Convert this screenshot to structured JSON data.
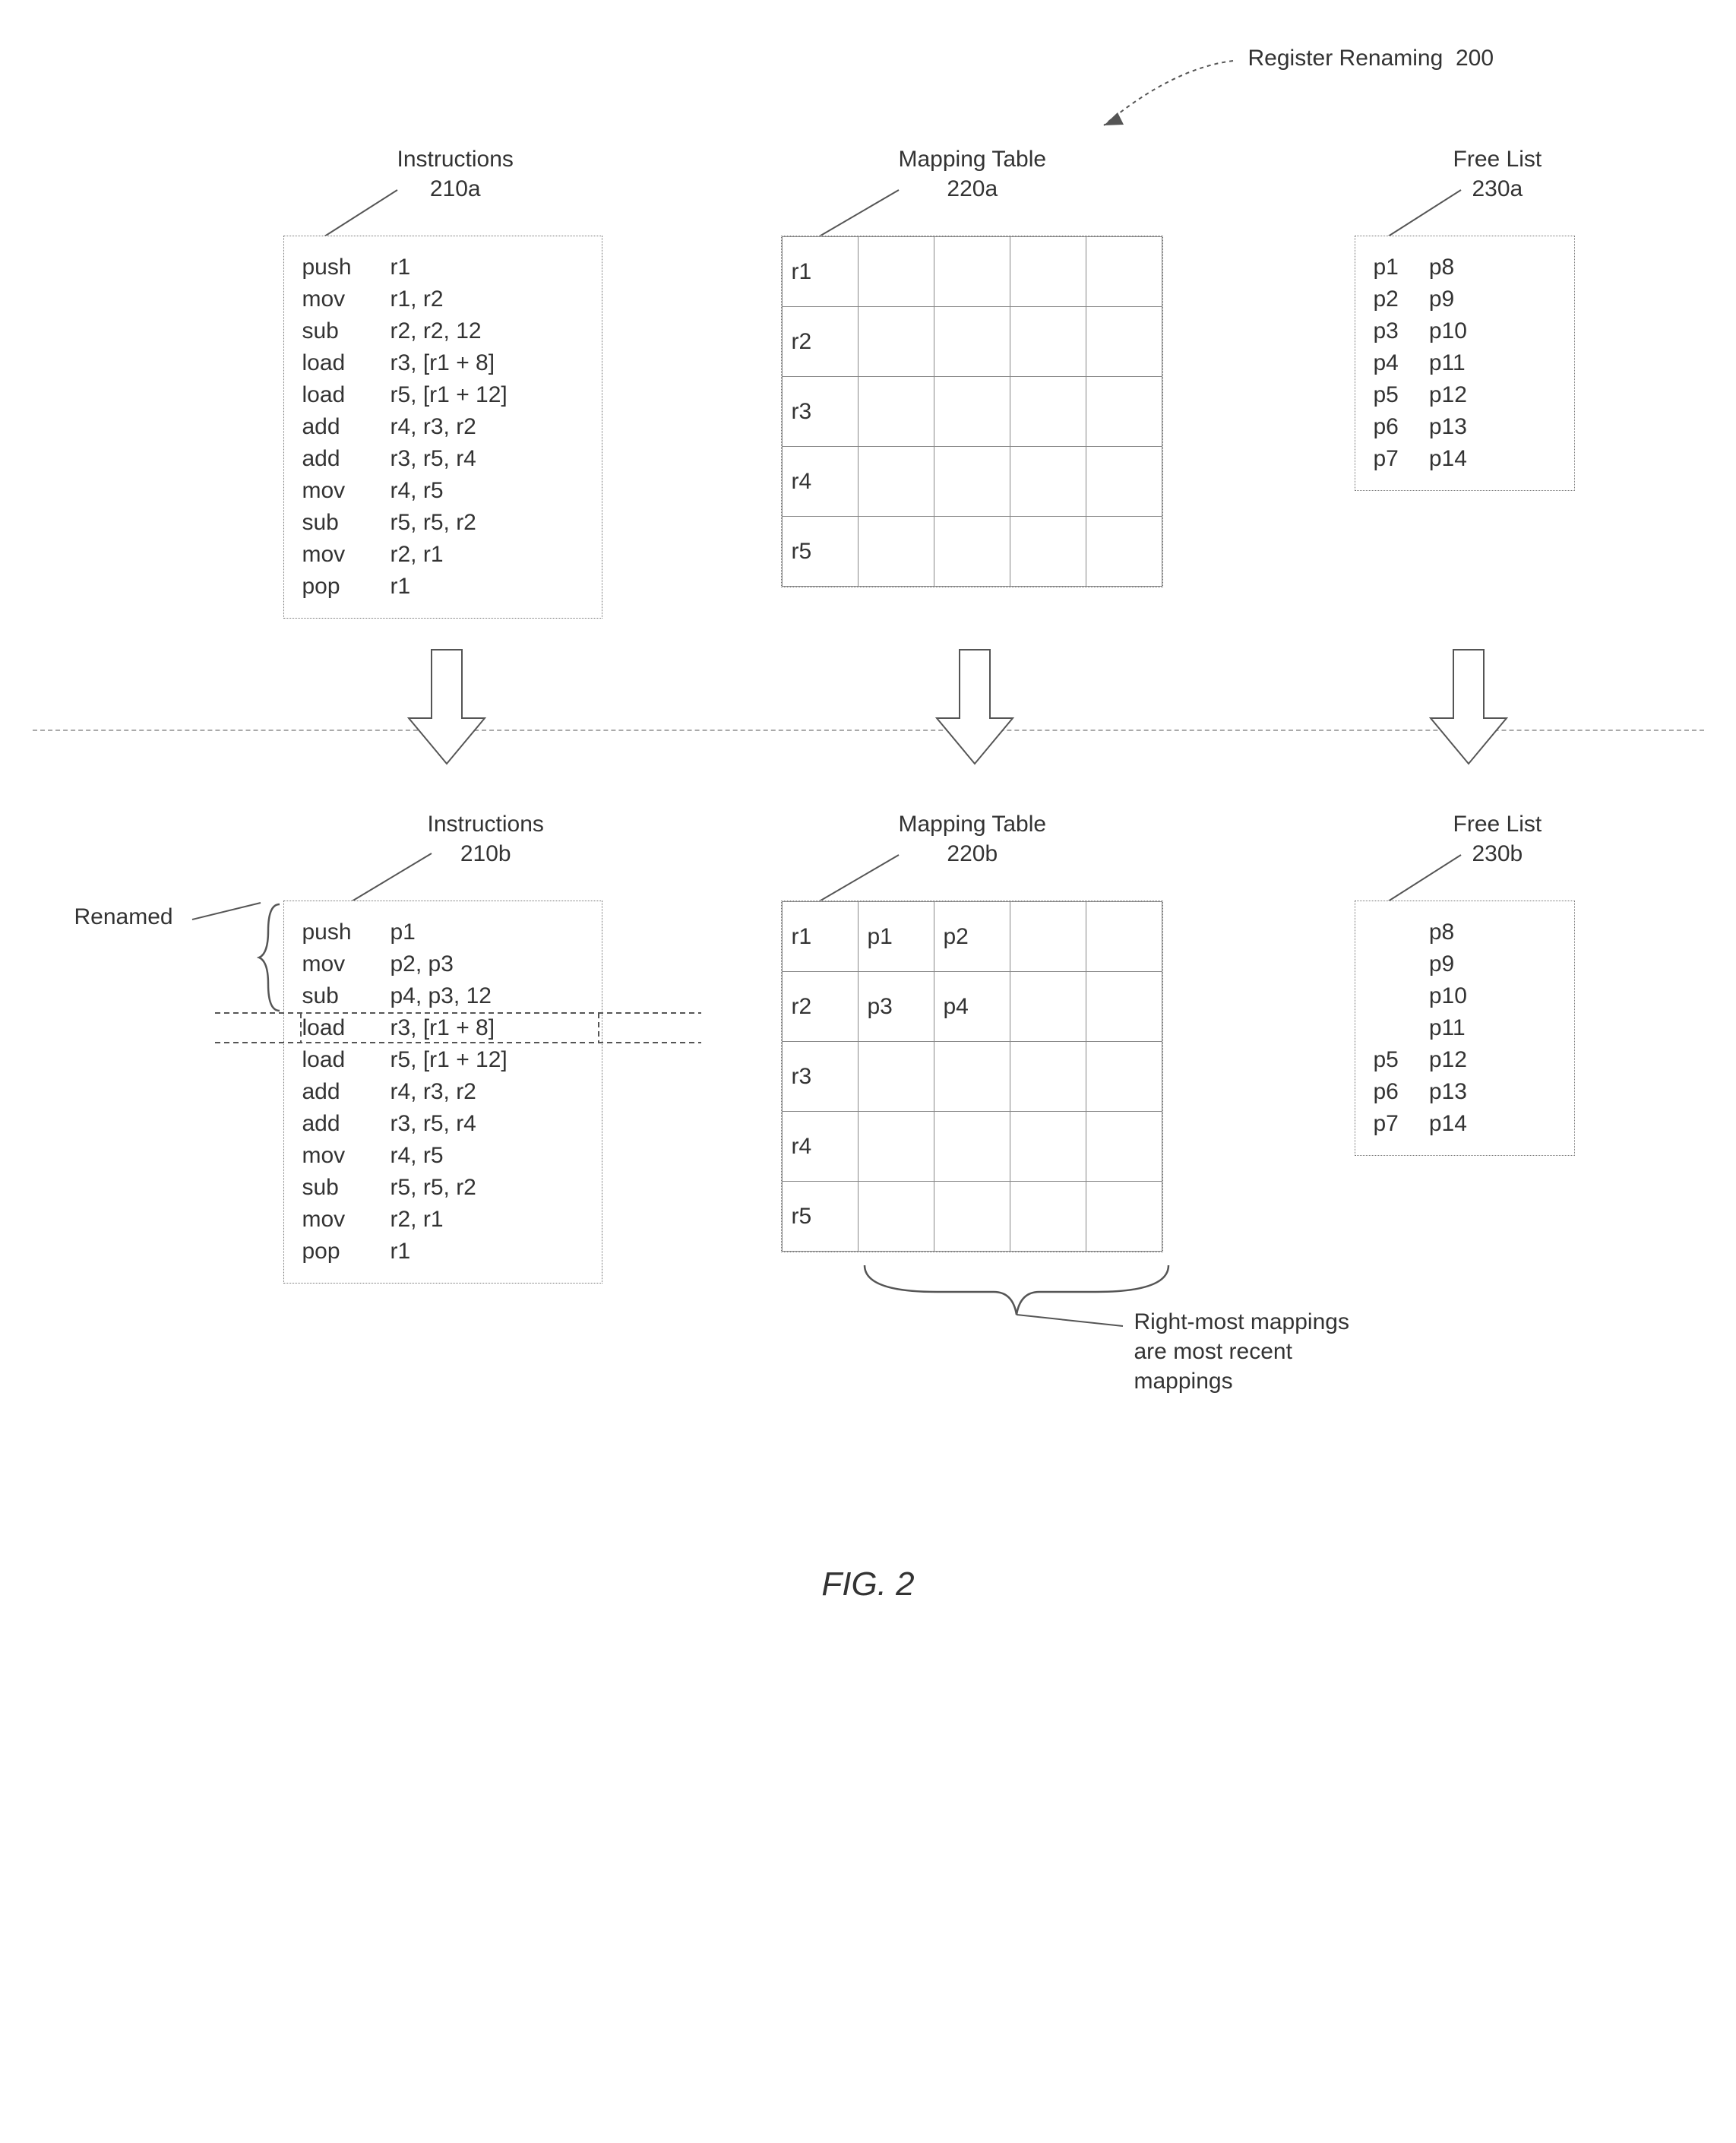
{
  "diagram": {
    "title": "Register Renaming",
    "title_num": "200",
    "instructions_a": {
      "label": "Instructions",
      "num": "210a",
      "row0": {
        "op": "push",
        "args": "r1"
      },
      "row1": {
        "op": "mov",
        "args": "r1, r2"
      },
      "row2": {
        "op": "sub",
        "args": "r2, r2, 12"
      },
      "row3": {
        "op": "load",
        "args": "r3, [r1 + 8]"
      },
      "row4": {
        "op": "load",
        "args": "r5, [r1 + 12]"
      },
      "row5": {
        "op": "add",
        "args": "r4, r3, r2"
      },
      "row6": {
        "op": "add",
        "args": "r3, r5, r4"
      },
      "row7": {
        "op": "mov",
        "args": "r4, r5"
      },
      "row8": {
        "op": "sub",
        "args": "r5, r5, r2"
      },
      "row9": {
        "op": "mov",
        "args": "r2, r1"
      },
      "row10": {
        "op": "pop",
        "args": "r1"
      }
    },
    "mapping_a": {
      "label": "Mapping Table",
      "num": "220a",
      "rows": {
        "r1": {
          "lbl": "r1",
          "c1": "",
          "c2": "",
          "c3": "",
          "c4": ""
        },
        "r2": {
          "lbl": "r2",
          "c1": "",
          "c2": "",
          "c3": "",
          "c4": ""
        },
        "r3": {
          "lbl": "r3",
          "c1": "",
          "c2": "",
          "c3": "",
          "c4": ""
        },
        "r4": {
          "lbl": "r4",
          "c1": "",
          "c2": "",
          "c3": "",
          "c4": ""
        },
        "r5": {
          "lbl": "r5",
          "c1": "",
          "c2": "",
          "c3": "",
          "c4": ""
        }
      }
    },
    "freelist_a": {
      "label": "Free List",
      "num": "230a",
      "col1": {
        "p0": "p1",
        "p1": "p2",
        "p2": "p3",
        "p3": "p4",
        "p4": "p5",
        "p5": "p6",
        "p6": "p7"
      },
      "col2": {
        "p0": "p8",
        "p1": "p9",
        "p2": "p10",
        "p3": "p11",
        "p4": "p12",
        "p5": "p13",
        "p6": "p14"
      }
    },
    "instructions_b": {
      "label": "Instructions",
      "num": "210b",
      "row0": {
        "op": "push",
        "args": "p1"
      },
      "row1": {
        "op": "mov",
        "args": "p2, p3"
      },
      "row2": {
        "op": "sub",
        "args": "p4, p3, 12"
      },
      "row3": {
        "op": "load",
        "args": "r3, [r1 + 8]"
      },
      "row4": {
        "op": "load",
        "args": "r5, [r1 + 12]"
      },
      "row5": {
        "op": "add",
        "args": "r4, r3, r2"
      },
      "row6": {
        "op": "add",
        "args": "r3, r5, r4"
      },
      "row7": {
        "op": "mov",
        "args": "r4, r5"
      },
      "row8": {
        "op": "sub",
        "args": "r5, r5, r2"
      },
      "row9": {
        "op": "mov",
        "args": "r2, r1"
      },
      "row10": {
        "op": "pop",
        "args": "r1"
      }
    },
    "mapping_b": {
      "label": "Mapping Table",
      "num": "220b",
      "rows": {
        "r1": {
          "lbl": "r1",
          "c1": "p1",
          "c2": "p2",
          "c3": "",
          "c4": ""
        },
        "r2": {
          "lbl": "r2",
          "c1": "p3",
          "c2": "p4",
          "c3": "",
          "c4": ""
        },
        "r3": {
          "lbl": "r3",
          "c1": "",
          "c2": "",
          "c3": "",
          "c4": ""
        },
        "r4": {
          "lbl": "r4",
          "c1": "",
          "c2": "",
          "c3": "",
          "c4": ""
        },
        "r5": {
          "lbl": "r5",
          "c1": "",
          "c2": "",
          "c3": "",
          "c4": ""
        }
      }
    },
    "freelist_b": {
      "label": "Free List",
      "num": "230b",
      "col1": {
        "p0": "",
        "p1": "",
        "p2": "",
        "p3": "",
        "p4": "p5",
        "p5": "p6",
        "p6": "p7"
      },
      "col2": {
        "p0": "p8",
        "p1": "p9",
        "p2": "p10",
        "p3": "p11",
        "p4": "p12",
        "p5": "p13",
        "p6": "p14"
      }
    },
    "renamed_label": "Renamed",
    "note": {
      "l1": "Right-most mappings",
      "l2": "are most recent",
      "l3": "mappings"
    },
    "fig_caption": "FIG. 2"
  }
}
